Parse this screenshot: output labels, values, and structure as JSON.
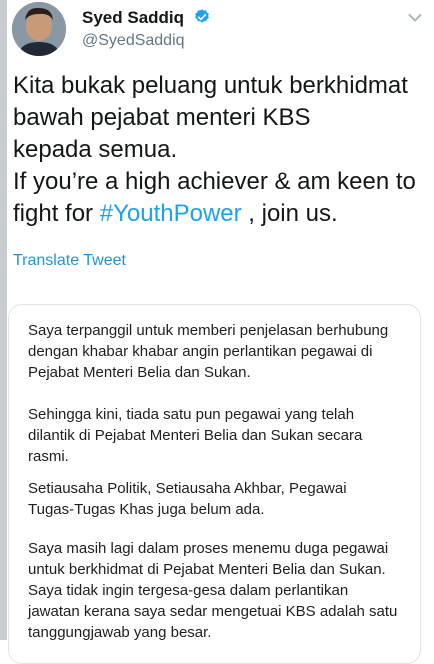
{
  "author": {
    "name": "Syed Saddiq",
    "handle": "@SyedSaddiq",
    "verified_color": "#1da1f2"
  },
  "tweet": {
    "text_before": "Kita bukak peluang untuk berkhidmat\nbawah pejabat menteri KBS\nkepada semua.\nIf you’re a high achiever & am keen to\nfight for ",
    "hashtag": "#YouthPower",
    "text_after": " , join us.",
    "translate_label": "Translate Tweet"
  },
  "statement": {
    "paragraphs": [
      "Saya terpanggil untuk memberi penjelasan berhubung\ndengan khabar khabar angin perlantikan pegawai di\nPejabat Menteri Belia dan Sukan.",
      "Sehingga kini, tiada satu pun pegawai yang telah\ndilantik di Pejabat Menteri Belia dan Sukan secara\nrasmi.",
      " Setiausaha Politik, Setiausaha Akhbar, Pegawai\nTugas-Tugas Khas juga belum ada.",
      "Saya masih lagi dalam proses menemu duga pegawai\nuntuk berkhidmat di Pejabat Menteri Belia dan Sukan.\nSaya tidak ingin tergesa-gesa dalam perlantikan\njawatan kerana saya sedar mengetuai KBS adalah satu\ntanggungjawab yang besar."
    ]
  },
  "icons": {
    "verified": "verified-badge-icon",
    "more": "chevron-down-icon"
  }
}
